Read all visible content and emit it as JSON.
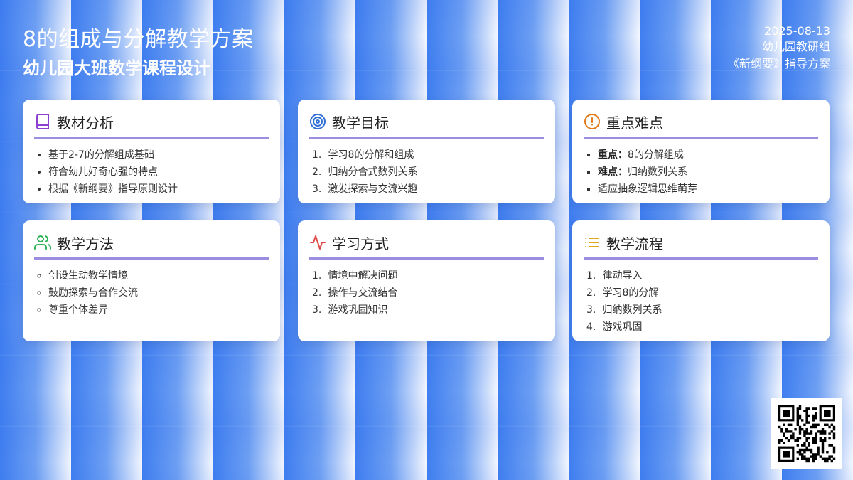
{
  "header": {
    "title": "8的组成与分解教学方案",
    "subtitle": "幼儿园大班数学课程设计",
    "date": "2025-08-13",
    "org": "幼儿园教研组",
    "guide": "《新纲要》指导方案"
  },
  "colors": {
    "accent_underline": "#9b8ee0",
    "icon_book": "#8a3fd1",
    "icon_target": "#2f6fd6",
    "icon_alert": "#e07a1a",
    "icon_users": "#2fb35a",
    "icon_pulse": "#e04848",
    "icon_list": "#e0a81a"
  },
  "cards": [
    {
      "title": "教材分析",
      "icon": "book-icon",
      "items": [
        "基于2-7的分解组成基础",
        "符合幼儿好奇心强的特点",
        "根据《新纲要》指导原则设计"
      ]
    },
    {
      "title": "教学目标",
      "icon": "target-icon",
      "items": [
        "学习8的分解和组成",
        "归纳分合式数列关系",
        "激发探索与交流兴趣"
      ]
    },
    {
      "title": "重点难点",
      "icon": "alert-icon",
      "items": [
        {
          "label": "重点：",
          "text": "8的分解组成"
        },
        {
          "label": "难点：",
          "text": "归纳数列关系"
        },
        {
          "label": "",
          "text": "适应抽象逻辑思维萌芽"
        }
      ]
    },
    {
      "title": "教学方法",
      "icon": "users-icon",
      "items": [
        "创设生动教学情境",
        "鼓励探索与合作交流",
        "尊重个体差异"
      ]
    },
    {
      "title": "学习方式",
      "icon": "pulse-icon",
      "items": [
        "情境中解决问题",
        "操作与交流结合",
        "游戏巩固知识"
      ]
    },
    {
      "title": "教学流程",
      "icon": "list-icon",
      "items": [
        "律动导入",
        "学习8的分解",
        "归纳数列关系",
        "游戏巩固"
      ]
    }
  ],
  "qr_code": {
    "icon": "qr-code-icon"
  }
}
